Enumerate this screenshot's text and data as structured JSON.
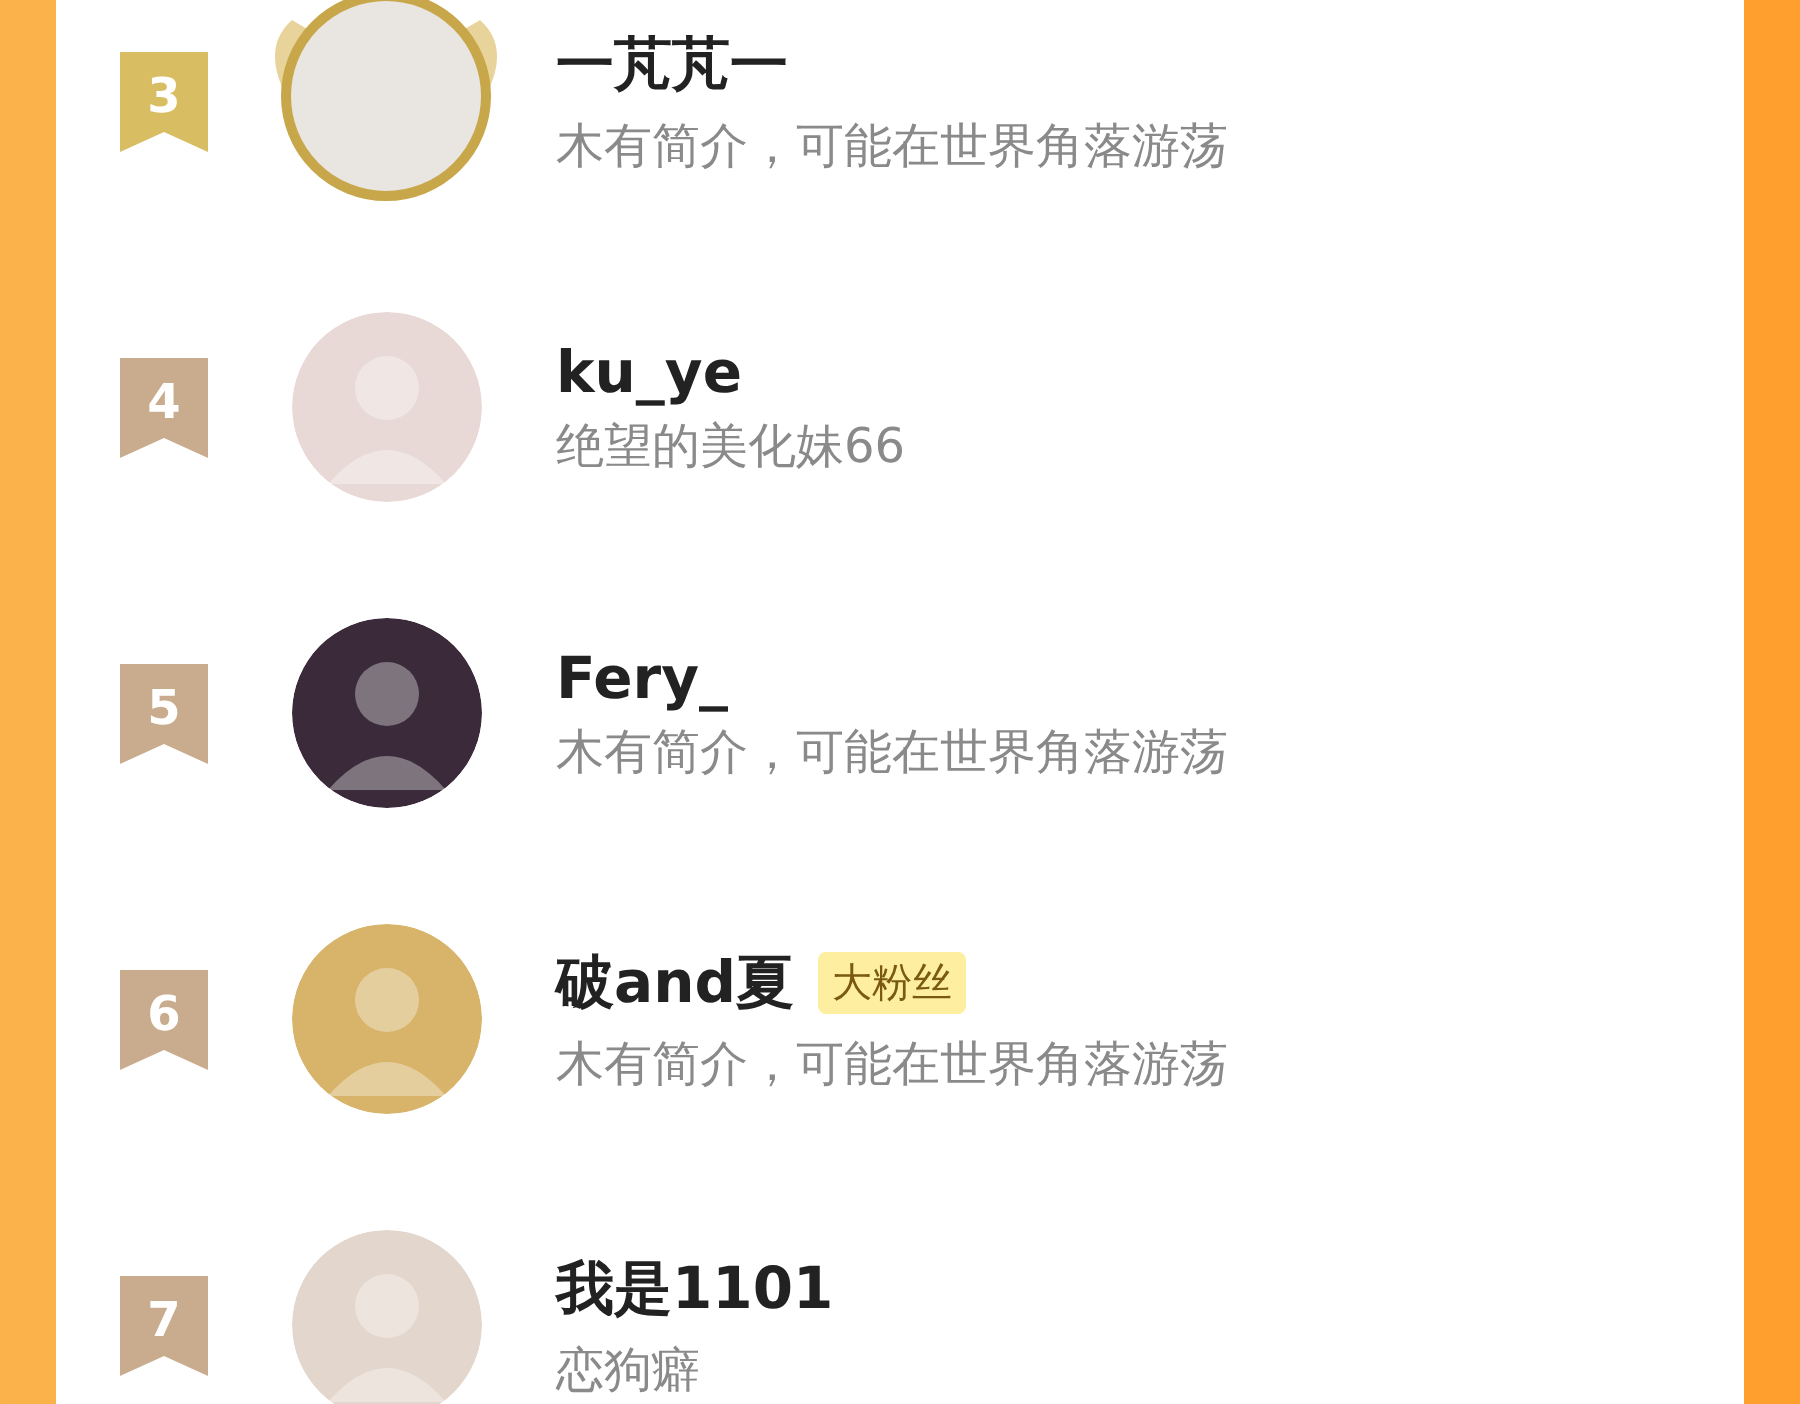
{
  "rankings": [
    {
      "rank": "3",
      "color": "#d9bd62",
      "kind": "winged",
      "name": "一芃芃一",
      "bio": "木有简介，可能在世界角落游荡"
    },
    {
      "rank": "4",
      "color": "#c9ac8e",
      "kind": "plain",
      "name": "ku_ye",
      "bio": "绝望的美化妹66"
    },
    {
      "rank": "5",
      "color": "#c9ac8e",
      "kind": "plain",
      "name": "Fery_",
      "bio": "木有简介，可能在世界角落游荡"
    },
    {
      "rank": "6",
      "color": "#c9ac8e",
      "kind": "plain",
      "name": "破and夏",
      "tag": "大粉丝",
      "bio": "木有简介，可能在世界角落游荡"
    },
    {
      "rank": "7",
      "color": "#c9ac8e",
      "kind": "plain",
      "name": "我是1101",
      "bio": "恋狗癖"
    }
  ]
}
